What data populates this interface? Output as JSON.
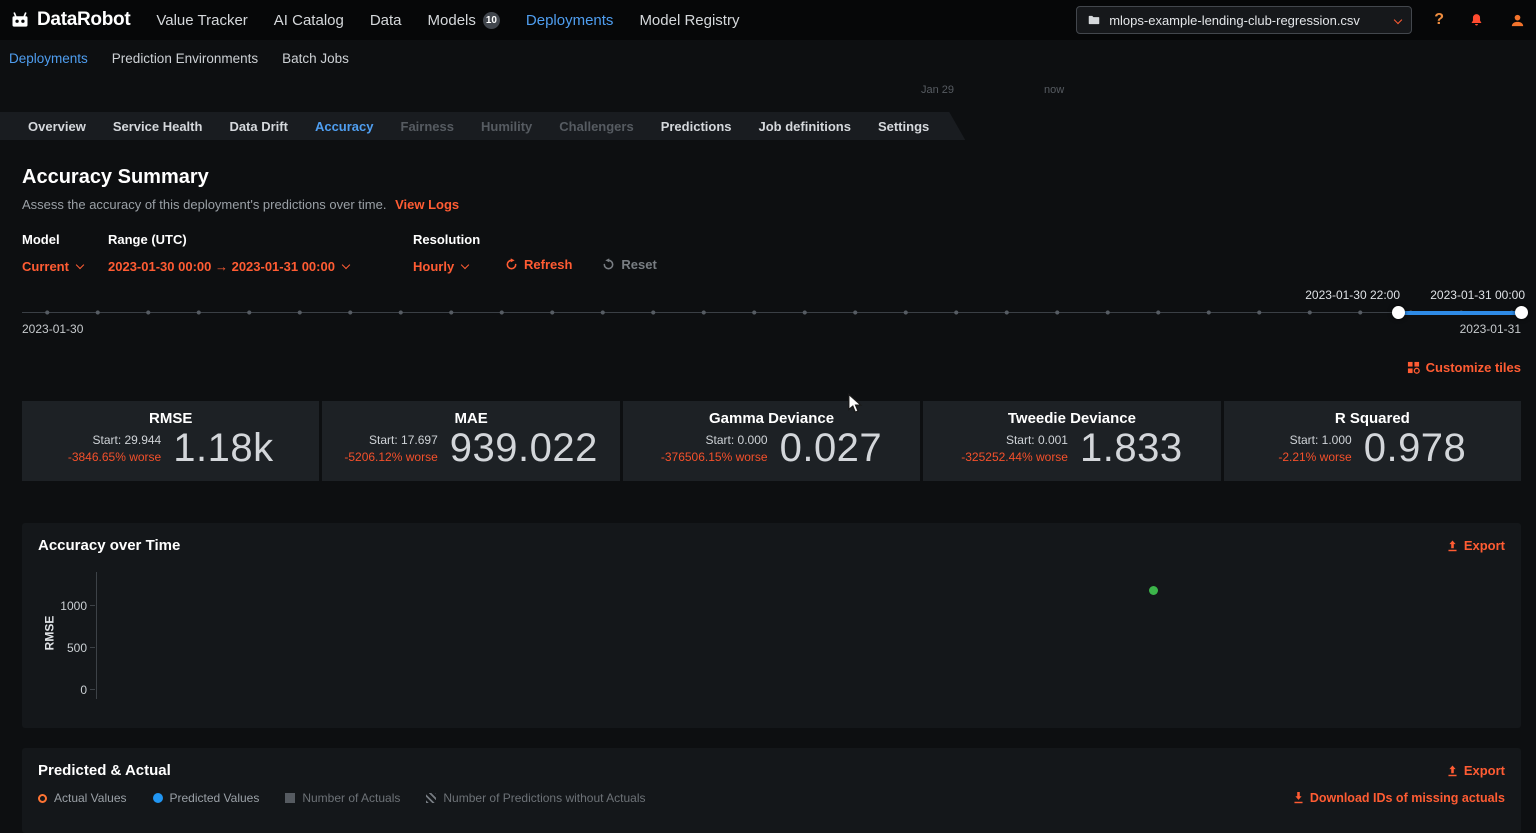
{
  "topnav": {
    "brand": "DataRobot",
    "items": [
      {
        "label": "Value Tracker"
      },
      {
        "label": "AI Catalog"
      },
      {
        "label": "Data"
      },
      {
        "label": "Models",
        "badge": "10"
      },
      {
        "label": "Deployments"
      },
      {
        "label": "Model Registry"
      }
    ],
    "dataset": "mlops-example-lending-club-regression.csv",
    "help": "?"
  },
  "subnav": {
    "items": [
      {
        "label": "Deployments"
      },
      {
        "label": "Prediction Environments"
      },
      {
        "label": "Batch Jobs"
      }
    ]
  },
  "remnant": {
    "left": "Jan 29",
    "right": "now"
  },
  "tabs": [
    {
      "label": "Overview"
    },
    {
      "label": "Service Health"
    },
    {
      "label": "Data Drift"
    },
    {
      "label": "Accuracy"
    },
    {
      "label": "Fairness"
    },
    {
      "label": "Humility"
    },
    {
      "label": "Challengers"
    },
    {
      "label": "Predictions"
    },
    {
      "label": "Job definitions"
    },
    {
      "label": "Settings"
    }
  ],
  "summary": {
    "title": "Accuracy Summary",
    "subtitle": "Assess the accuracy of this deployment's predictions over time.",
    "view_logs": "View Logs",
    "model_label": "Model",
    "model_value": "Current",
    "range_label": "Range (UTC)",
    "range_value": "2023-01-30  00:00 → 2023-01-31  00:00",
    "resolution_label": "Resolution",
    "resolution_value": "Hourly",
    "refresh": "Refresh",
    "reset": "Reset"
  },
  "slider": {
    "start_label": "2023-01-30 22:00",
    "end_label": "2023-01-31 00:00",
    "range_start": "2023-01-30",
    "range_end": "2023-01-31"
  },
  "customize_tiles": "Customize tiles",
  "tiles": [
    {
      "name": "RMSE",
      "start": "Start: 29.944",
      "change": "-3846.65% worse",
      "value": "1.18k"
    },
    {
      "name": "MAE",
      "start": "Start: 17.697",
      "change": "-5206.12% worse",
      "value": "939.022"
    },
    {
      "name": "Gamma Deviance",
      "start": "Start: 0.000",
      "change": "-376506.15% worse",
      "value": "0.027"
    },
    {
      "name": "Tweedie Deviance",
      "start": "Start: 0.001",
      "change": "-325252.44% worse",
      "value": "1.833"
    },
    {
      "name": "R Squared",
      "start": "Start: 1.000",
      "change": "-2.21% worse",
      "value": "0.978"
    }
  ],
  "accuracy_chart": {
    "title": "Accuracy over Time",
    "export": "Export",
    "ylabel": "RMSE",
    "yticks": [
      "1000",
      "500",
      "0"
    ]
  },
  "chart_data": {
    "type": "scatter",
    "title": "Accuracy over Time",
    "xlabel": "",
    "ylabel": "RMSE",
    "ylim": [
      0,
      1250
    ],
    "yticks": [
      0,
      500,
      1000
    ],
    "points": [
      {
        "x": "2023-01-30 22:00",
        "y": 1180,
        "xfrac": 0.758
      }
    ],
    "point_color": "#3cb54a",
    "legend_position": "none",
    "grid": false
  },
  "predicted_actual": {
    "title": "Predicted & Actual",
    "export": "Export",
    "legend": [
      {
        "label": "Actual Values",
        "type": "ring-orange"
      },
      {
        "label": "Predicted Values",
        "type": "dot-blue"
      },
      {
        "label": "Number of Actuals",
        "type": "square-grey"
      },
      {
        "label": "Number of Predictions without Actuals",
        "type": "square-hatched"
      }
    ],
    "download": "Download IDs of missing actuals"
  }
}
